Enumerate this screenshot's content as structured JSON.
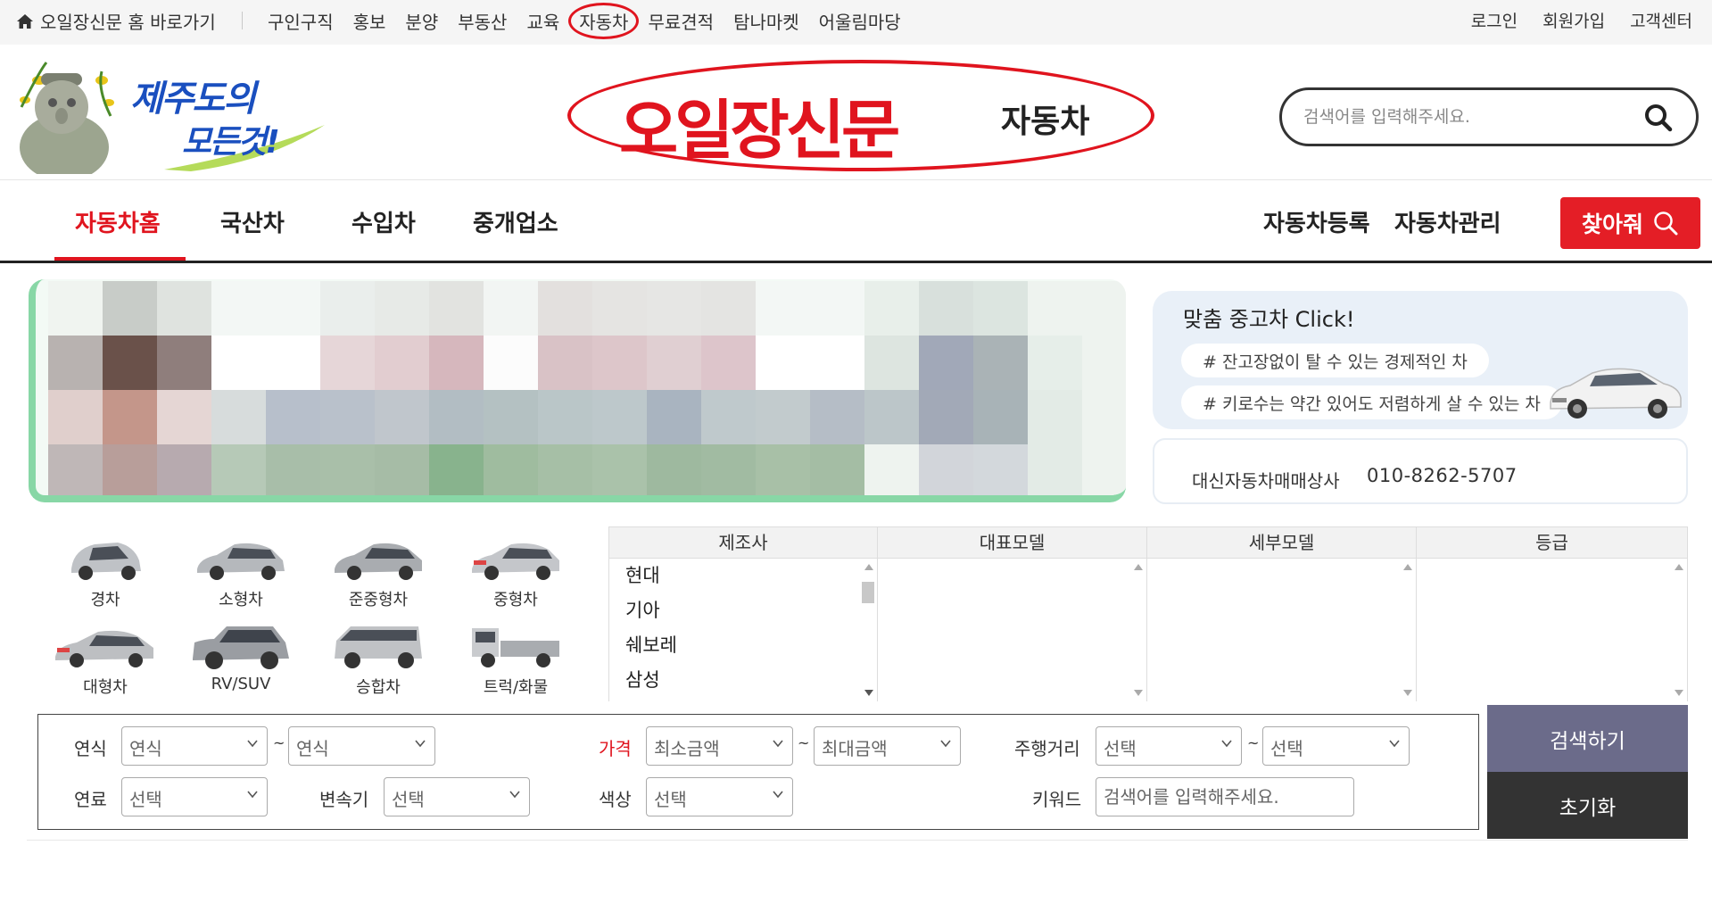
{
  "topbar": {
    "home_link": "오일장신문 홈 바로가기",
    "menu": [
      "구인구직",
      "홍보",
      "분양",
      "부동산",
      "교육",
      "자동차",
      "무료견적",
      "탐나마켓",
      "어울림마당"
    ],
    "highlighted_menu": "자동차",
    "account": [
      "로그인",
      "회원가입",
      "고객센터"
    ]
  },
  "header": {
    "jeju_logo_line1": "제주도의",
    "jeju_logo_line2": "모든것!",
    "logo_text": "오일장신문",
    "logo_sub": "자동차",
    "search_placeholder": "검색어를 입력해주세요."
  },
  "nav": {
    "items": [
      "자동차홈",
      "국산차",
      "수입차",
      "중개업소"
    ],
    "active": "자동차홈",
    "right_links": [
      "자동차등록",
      "자동차관리"
    ],
    "find_button": "찾아줘"
  },
  "promo": {
    "title": "맞춤 중고차 Click!",
    "tags": [
      "# 잔고장없이 탈 수 있는 경제적인 차",
      "# 키로수는 약간 있어도 저렴하게 살 수 있는 차"
    ]
  },
  "dealer": {
    "name": "대신자동차매매상사",
    "phone": "010-8262-5707"
  },
  "car_types": [
    "경차",
    "소형차",
    "준중형차",
    "중형차",
    "대형차",
    "RV/SUV",
    "승합차",
    "트럭/화물"
  ],
  "selector": {
    "headers": [
      "제조사",
      "대표모델",
      "세부모델",
      "등급"
    ],
    "manufacturers": [
      "현대",
      "기아",
      "쉐보레",
      "삼성"
    ]
  },
  "filter": {
    "year_label": "연식",
    "year_from": "연식",
    "year_to": "연식",
    "price_label": "가격",
    "price_min": "최소금액",
    "price_max": "최대금액",
    "mileage_label": "주행거리",
    "mileage_from": "선택",
    "mileage_to": "선택",
    "fuel_label": "연료",
    "fuel_value": "선택",
    "trans_label": "변속기",
    "trans_value": "선택",
    "color_label": "색상",
    "color_value": "선택",
    "keyword_label": "키워드",
    "keyword_placeholder": "검색어를 입력해주세요.",
    "tilde": "~",
    "search_button": "검색하기",
    "reset_button": "초기화"
  },
  "colors": {
    "accent_red": "#e0141e",
    "find_button": "#e41e26",
    "search_button": "#6b6b8a",
    "reset_button": "#333333",
    "banner_border": "#88d7a6"
  }
}
